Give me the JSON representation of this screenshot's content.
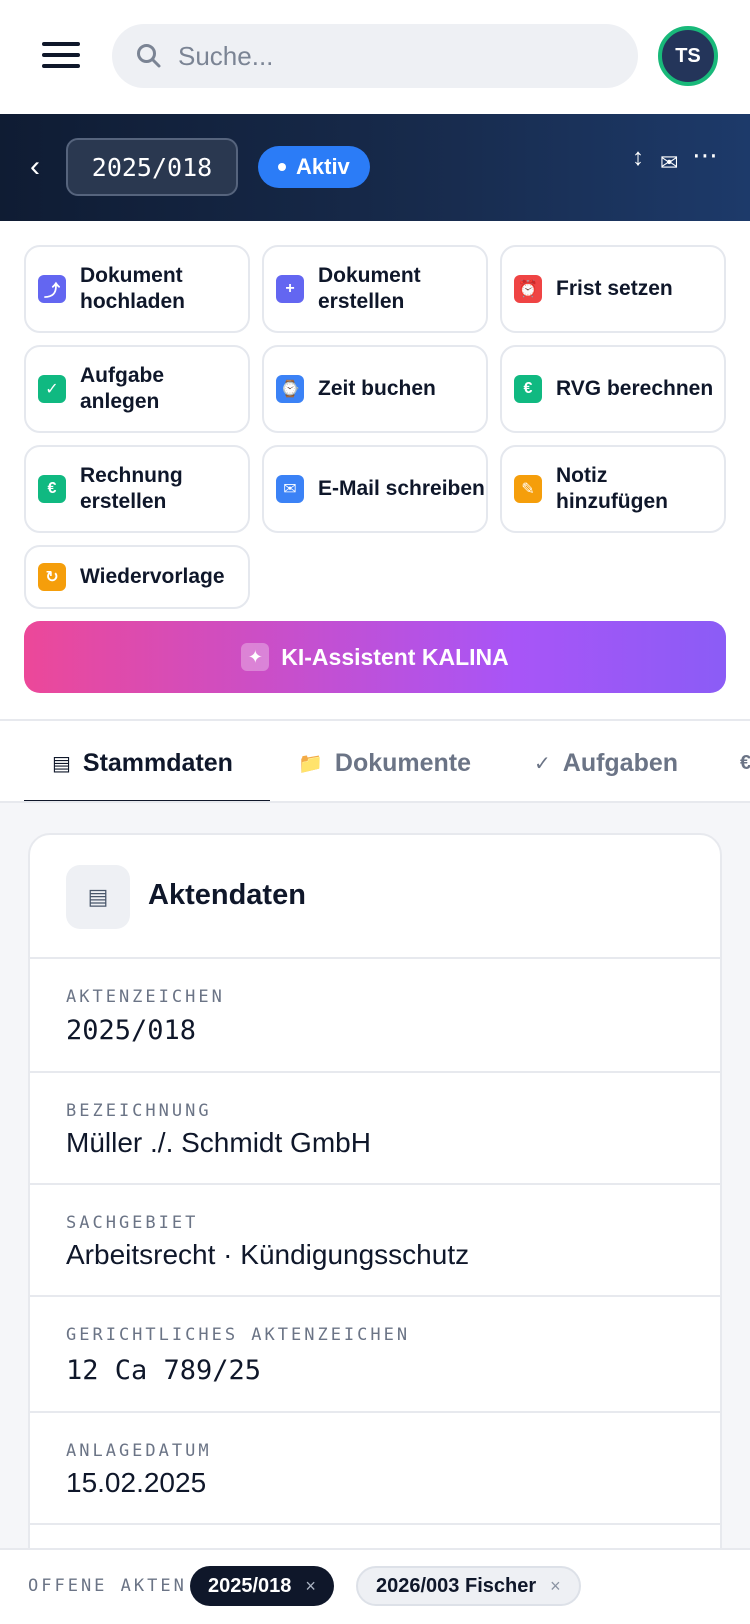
{
  "search": {
    "placeholder": "Suche..."
  },
  "user": {
    "initials": "TS"
  },
  "case": {
    "number": "2025/018",
    "status": "Aktiv"
  },
  "header_icons": {
    "sort": "↕",
    "mail": "✉",
    "more": "⋯"
  },
  "actions": [
    {
      "label": "Dokument hochladen",
      "icon": "upload-icon",
      "glyph": "⤴",
      "color": "#6366f1"
    },
    {
      "label": "Dokument erstellen",
      "icon": "plus-icon",
      "glyph": "+",
      "color": "#6366f1"
    },
    {
      "label": "Frist setzen",
      "icon": "alarm-clock-icon",
      "glyph": "⏰",
      "color": "#ef4444"
    },
    {
      "label": "Aufgabe anlegen",
      "icon": "check-icon",
      "glyph": "✓",
      "color": "#10b981"
    },
    {
      "label": "Zeit buchen",
      "icon": "watch-icon",
      "glyph": "⌚",
      "color": "#3b82f6"
    },
    {
      "label": "RVG berechnen",
      "icon": "euro-icon",
      "glyph": "€",
      "color": "#10b981"
    },
    {
      "label": "Rechnung erstellen",
      "icon": "euro-icon",
      "glyph": "€",
      "color": "#10b981"
    },
    {
      "label": "E-Mail schreiben",
      "icon": "envelope-icon",
      "glyph": "✉",
      "color": "#3b82f6"
    },
    {
      "label": "Notiz hinzufügen",
      "icon": "pencil-icon",
      "glyph": "✎",
      "color": "#f59e0b"
    },
    {
      "label": "Wiedervorlage",
      "icon": "refresh-icon",
      "glyph": "↻",
      "color": "#f59e0b"
    }
  ],
  "ai": {
    "label": "KI-Assistent KALINA",
    "glyph": "✦"
  },
  "tabs": [
    {
      "label": "Stammdaten",
      "glyph": "▤",
      "icon": "list-icon"
    },
    {
      "label": "Dokumente",
      "glyph": "📁",
      "icon": "folder-icon"
    },
    {
      "label": "Aufgaben",
      "glyph": "✓",
      "icon": "check-icon"
    },
    {
      "label": "",
      "glyph": "€",
      "icon": "euro-icon"
    }
  ],
  "card": {
    "title": "Aktendaten",
    "glyph": "▤",
    "fields": [
      {
        "key": "AKTENZEICHEN",
        "value": "2025/018"
      },
      {
        "key": "BEZEICHNUNG",
        "value": "Müller ./. Schmidt GmbH"
      },
      {
        "key": "SACHGEBIET",
        "value": "Arbeitsrecht · Kündigungsschutz"
      },
      {
        "key": "GERICHTLICHES AKTENZEICHEN",
        "value": "12 Ca 789/25"
      },
      {
        "key": "ANLAGEDATUM",
        "value": "15.02.2025"
      }
    ]
  },
  "open_cases": {
    "label": "OFFENE AKTEN",
    "chips": [
      {
        "label": "2025/018",
        "close": "×"
      },
      {
        "label": "2026/003 Fischer",
        "close": "×"
      }
    ]
  },
  "colors": {
    "accent": "#2b7cf7",
    "dark": "#0f172a",
    "avatar_ring": "#19b97a"
  }
}
